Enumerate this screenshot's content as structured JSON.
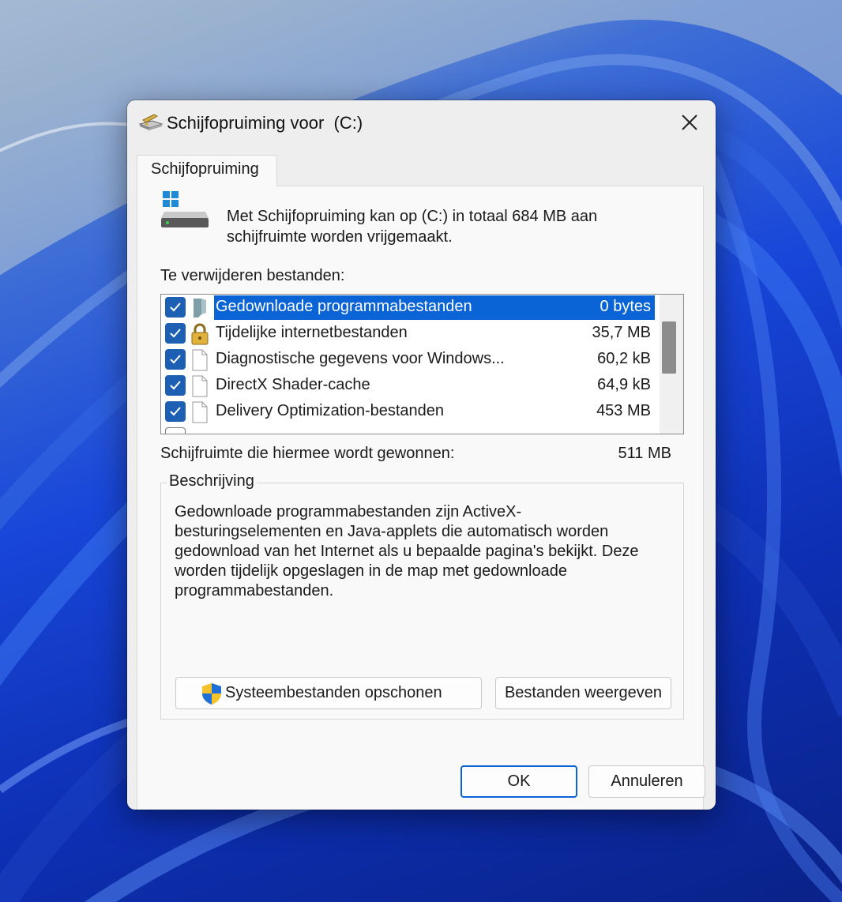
{
  "window": {
    "title": "Schijfopruiming voor  (C:)",
    "close_glyph": "✕"
  },
  "tab": {
    "label": "Schijfopruiming"
  },
  "intro": "Met Schijfopruiming kan op  (C:) in totaal 684 MB aan\nschijfruimte worden vrijgemaakt.",
  "files_label": "Te verwijderen bestanden:",
  "files": [
    {
      "name": "Gedownloade programmabestanden",
      "size": "0 bytes",
      "checked": true,
      "selected": true,
      "icon": "folder-icon"
    },
    {
      "name": "Tijdelijke internetbestanden",
      "size": "35,7 MB",
      "checked": true,
      "selected": false,
      "icon": "lock-icon"
    },
    {
      "name": "Diagnostische gegevens voor Windows...",
      "size": "60,2 kB",
      "checked": true,
      "selected": false,
      "icon": "file-icon"
    },
    {
      "name": "DirectX Shader-cache",
      "size": "64,9 kB",
      "checked": true,
      "selected": false,
      "icon": "file-icon"
    },
    {
      "name": "Delivery Optimization-bestanden",
      "size": "453 MB",
      "checked": true,
      "selected": false,
      "icon": "file-icon"
    }
  ],
  "gain": {
    "label": "Schijfruimte die hiermee wordt gewonnen:",
    "value": "511 MB"
  },
  "description": {
    "legend": "Beschrijving",
    "text": "Gedownloade programmabestanden zijn ActiveX-besturingselementen en Java-applets die automatisch worden gedownload van het Internet als u bepaalde pagina's bekijkt. Deze worden tijdelijk opgeslagen in de map met gedownloade programmabestanden."
  },
  "buttons": {
    "system_cleanup": "Systeembestanden opschonen",
    "view_files": "Bestanden weergeven",
    "ok": "OK",
    "cancel": "Annuleren"
  },
  "colors": {
    "accent": "#0a64d6",
    "checkbox": "#1d5fb3",
    "desktop": "#1846d8"
  }
}
